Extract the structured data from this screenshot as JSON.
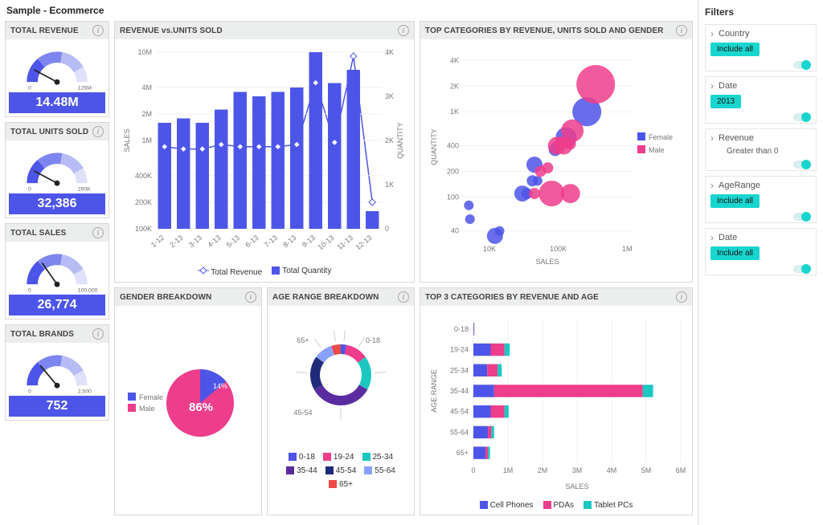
{
  "title": "Sample - Ecommerce",
  "kpis": {
    "revenue": {
      "title": "TOTAL REVENUE",
      "value": "14.48M",
      "min": "0",
      "max": "125M",
      "angle_deg": -62
    },
    "units": {
      "title": "TOTAL UNITS SOLD",
      "value": "32,386",
      "min": "0",
      "max": "250K",
      "angle_deg": -62
    },
    "sales": {
      "title": "TOTAL SALES",
      "value": "26,774",
      "min": "0",
      "max": "100,000",
      "angle_deg": -35
    },
    "brands": {
      "title": "TOTAL BRANDS",
      "value": "752",
      "min": "0",
      "max": "2,500",
      "angle_deg": -40
    }
  },
  "revenue_units": {
    "title": "REVENUE vs.UNITS SOLD",
    "left_axis_label": "SALES",
    "right_axis_label": "QUANTITY",
    "legend": {
      "line": "Total Revenue",
      "bar": "Total Quantity"
    }
  },
  "bubble": {
    "title": "TOP CATEGORIES BY REVENUE, UNITS SOLD AND GENDER",
    "xlabel": "SALES",
    "ylabel": "QUANTITY",
    "legend": [
      "Female",
      "Male"
    ]
  },
  "gender": {
    "title": "GENDER BREAKDOWN",
    "labels": [
      "Female",
      "Male"
    ],
    "inner_label_male": "14%",
    "inner_label_female": "86%"
  },
  "age": {
    "title": "AGE RANGE BREAKDOWN"
  },
  "top3": {
    "title": "TOP 3 CATEGORIES BY REVENUE AND AGE",
    "xlabel": "SALES",
    "ylabel": "AGE RANGE",
    "legend": [
      "Cell Phones",
      "PDAs",
      "Tablet PCs"
    ]
  },
  "chart_data": {
    "revenue_vs_units": {
      "type": "bar+line",
      "categories": [
        "1-12",
        "2-13",
        "3-13",
        "4-13",
        "5-13",
        "6-13",
        "7-13",
        "8-13",
        "9-13",
        "10-13",
        "11-13",
        "12-13"
      ],
      "bar_series": {
        "name": "Total Quantity",
        "values": [
          2400,
          2500,
          2400,
          2700,
          3100,
          3000,
          3100,
          3200,
          4000,
          3300,
          3600,
          400
        ],
        "axis": "right",
        "ylim": [
          0,
          4000
        ],
        "ticks": [
          "0",
          "1K",
          "2K",
          "3K",
          "4K"
        ]
      },
      "line_series": {
        "name": "Total Revenue",
        "values": [
          850000,
          800000,
          800000,
          900000,
          850000,
          850000,
          850000,
          900000,
          4500000,
          950000,
          9000000,
          200000
        ],
        "axis": "left",
        "ylim_log_like": true,
        "ticks": [
          "100K",
          "200K",
          "400K",
          "1M",
          "2M",
          "4M",
          "10M"
        ]
      }
    },
    "bubble": {
      "type": "bubble",
      "x_scale": "log",
      "x_ticks": [
        "10K",
        "100K",
        "1M"
      ],
      "y_scale": "log",
      "y_ticks": [
        "40",
        "100",
        "200",
        "400",
        "1K",
        "2K",
        "4K"
      ],
      "series": [
        {
          "name": "Female",
          "color": "#4d55e8",
          "points": [
            {
              "x": 5000,
              "y": 80,
              "r": 6
            },
            {
              "x": 5200,
              "y": 55,
              "r": 6
            },
            {
              "x": 12000,
              "y": 35,
              "r": 10
            },
            {
              "x": 14000,
              "y": 40,
              "r": 6
            },
            {
              "x": 30000,
              "y": 110,
              "r": 10
            },
            {
              "x": 35000,
              "y": 110,
              "r": 7
            },
            {
              "x": 42000,
              "y": 155,
              "r": 7
            },
            {
              "x": 50000,
              "y": 155,
              "r": 6
            },
            {
              "x": 45000,
              "y": 240,
              "r": 10
            },
            {
              "x": 90000,
              "y": 360,
              "r": 8
            },
            {
              "x": 100000,
              "y": 400,
              "r": 7
            },
            {
              "x": 130000,
              "y": 500,
              "r": 13
            },
            {
              "x": 260000,
              "y": 1000,
              "r": 18
            }
          ]
        },
        {
          "name": "Male",
          "color": "#ee3d8b",
          "points": [
            {
              "x": 45000,
              "y": 110,
              "r": 7
            },
            {
              "x": 55000,
              "y": 200,
              "r": 7
            },
            {
              "x": 80000,
              "y": 110,
              "r": 16
            },
            {
              "x": 150000,
              "y": 110,
              "r": 12
            },
            {
              "x": 70000,
              "y": 220,
              "r": 7
            },
            {
              "x": 95000,
              "y": 400,
              "r": 11
            },
            {
              "x": 120000,
              "y": 400,
              "r": 11
            },
            {
              "x": 110000,
              "y": 430,
              "r": 8
            },
            {
              "x": 150000,
              "y": 420,
              "r": 7
            },
            {
              "x": 160000,
              "y": 600,
              "r": 14
            },
            {
              "x": 350000,
              "y": 2100,
              "r": 24
            }
          ]
        }
      ]
    },
    "gender": {
      "type": "pie",
      "slices": [
        {
          "name": "Male",
          "value": 14,
          "color": "#4d55e8"
        },
        {
          "name": "Female",
          "value": 86,
          "color": "#ee3d8b"
        }
      ]
    },
    "age_donut": {
      "type": "donut",
      "slices": [
        {
          "name": "0-18",
          "value": 3,
          "color": "#4d55e8"
        },
        {
          "name": "19-24",
          "value": 12,
          "color": "#ee3d8b"
        },
        {
          "name": "25-34",
          "value": 18,
          "color": "#1bc7c0"
        },
        {
          "name": "35-44",
          "value": 34,
          "color": "#5a2ca0"
        },
        {
          "name": "45-54",
          "value": 18,
          "color": "#1f2a7a"
        },
        {
          "name": "55-64",
          "value": 10,
          "color": "#8aa1ff"
        },
        {
          "name": "65+",
          "value": 5,
          "color": "#ef4a4a"
        }
      ]
    },
    "top3_by_age": {
      "type": "stacked-bar-h",
      "categories": [
        "0-18",
        "19-24",
        "25-34",
        "35-44",
        "45-54",
        "55-64",
        "65+"
      ],
      "series": [
        {
          "name": "Cell Phones",
          "color": "#4d55e8",
          "values": [
            20000,
            500000,
            400000,
            600000,
            500000,
            420000,
            350000
          ]
        },
        {
          "name": "PDAs",
          "color": "#ee3d8b",
          "values": [
            5000,
            400000,
            300000,
            4300000,
            400000,
            100000,
            70000
          ]
        },
        {
          "name": "Tablet PCs",
          "color": "#1bc7c0",
          "values": [
            3000,
            150000,
            120000,
            300000,
            120000,
            80000,
            60000
          ]
        }
      ],
      "x_ticks": [
        "0",
        "1M",
        "2M",
        "3M",
        "4M",
        "5M",
        "6M"
      ],
      "xlim": [
        0,
        6000000
      ]
    }
  },
  "filters": {
    "title": "Filters",
    "items": [
      {
        "name": "Country",
        "type": "pill",
        "value": "Include all"
      },
      {
        "name": "Date",
        "type": "pill",
        "value": "2013"
      },
      {
        "name": "Revenue",
        "type": "text",
        "value": "Greater than 0"
      },
      {
        "name": "AgeRange",
        "type": "pill",
        "value": "Include all"
      },
      {
        "name": "Date",
        "type": "pill",
        "value": "Include all"
      }
    ]
  }
}
